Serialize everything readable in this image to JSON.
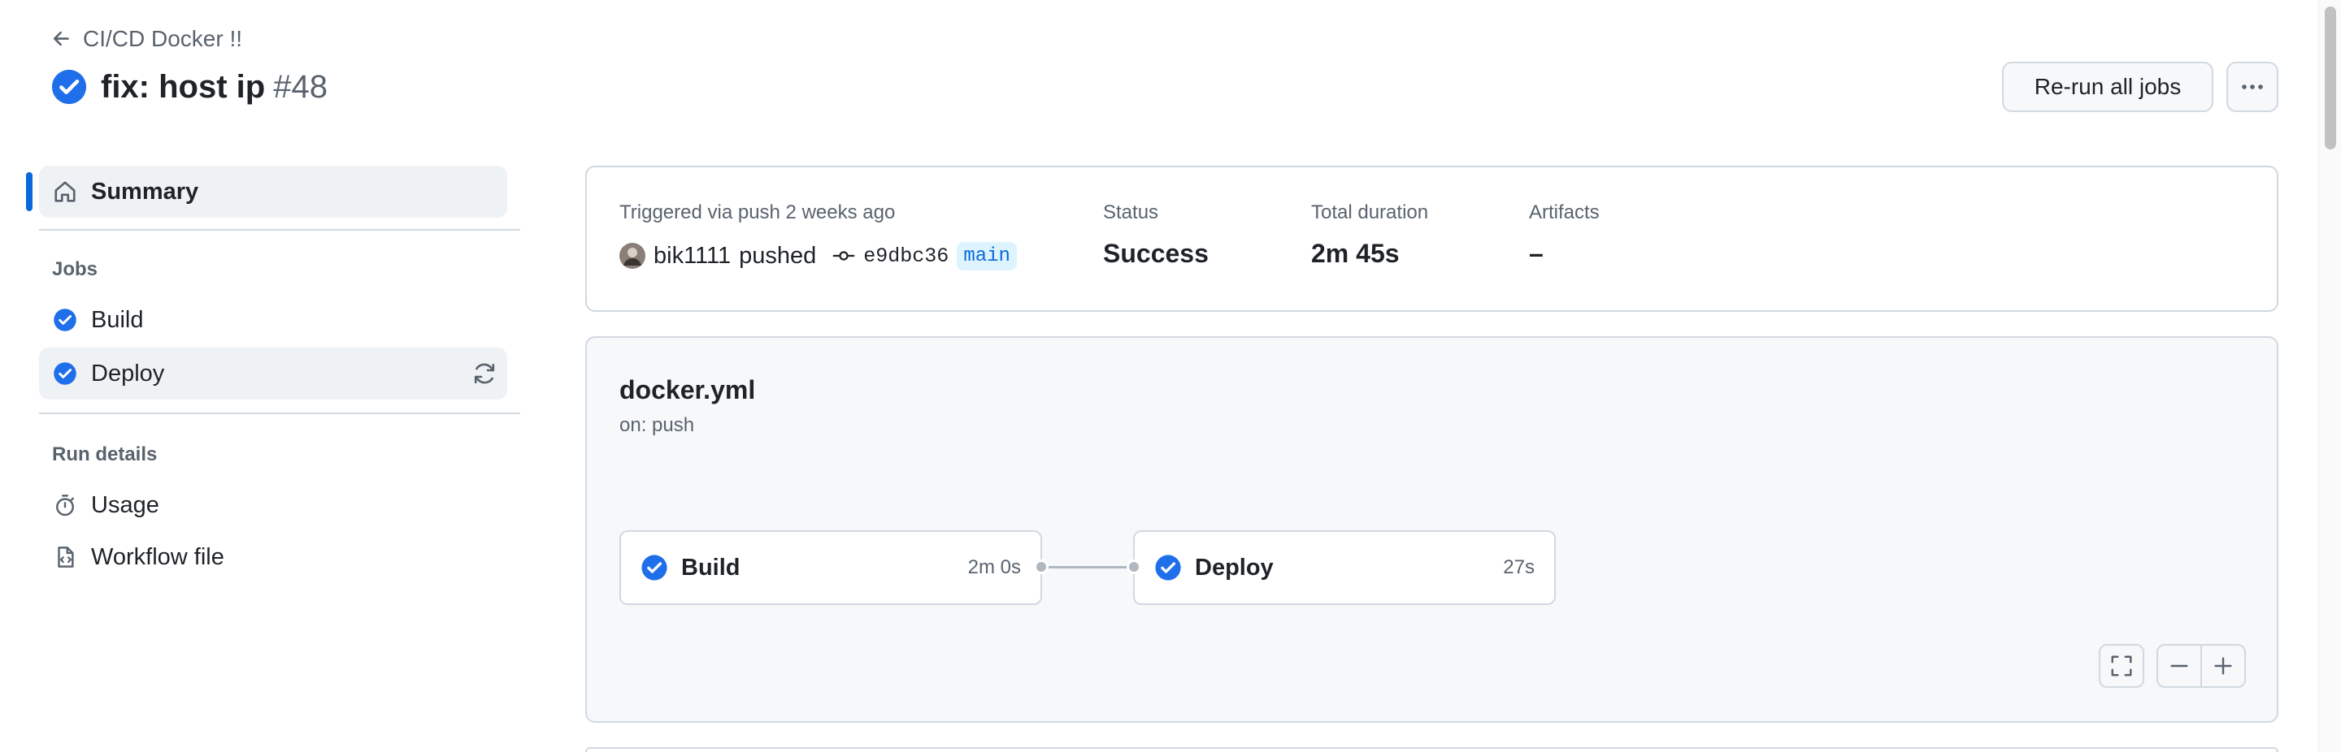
{
  "header": {
    "back_label": "CI/CD Docker !!",
    "title": "fix: host ip",
    "run_number": "#48",
    "rerun_label": "Re-run all jobs"
  },
  "sidebar": {
    "summary_label": "Summary",
    "jobs_heading": "Jobs",
    "jobs": [
      {
        "label": "Build"
      },
      {
        "label": "Deploy"
      }
    ],
    "run_details_heading": "Run details",
    "details": [
      {
        "label": "Usage"
      },
      {
        "label": "Workflow file"
      }
    ]
  },
  "summary": {
    "trigger_text": "Triggered via push 2 weeks ago",
    "actor": "bik1111",
    "action": "pushed",
    "commit": "e9dbc36",
    "branch": "main",
    "status_label": "Status",
    "status_value": "Success",
    "duration_label": "Total duration",
    "duration_value": "2m 45s",
    "artifacts_label": "Artifacts",
    "artifacts_value": "–"
  },
  "workflow": {
    "file": "docker.yml",
    "trigger": "on: push",
    "jobs": [
      {
        "name": "Build",
        "duration": "2m 0s"
      },
      {
        "name": "Deploy",
        "duration": "27s"
      }
    ]
  },
  "colors": {
    "success": "#1f6feb",
    "accent_bar": "#0969da",
    "border": "#d1d9e0",
    "muted_text": "#59636e",
    "panel_bg": "#f6f8fa",
    "branch_bg": "#ddf4ff"
  },
  "icons": {
    "back": "arrow-left-icon",
    "status": "check-circle-fill-icon",
    "more": "kebab-horizontal-icon",
    "summary": "home-icon",
    "job_status": "check-circle-fill-icon",
    "rerun": "sync-icon",
    "usage": "stopwatch-icon",
    "workflow_file": "file-code-icon",
    "commit": "git-commit-icon",
    "fullscreen": "screen-full-icon",
    "zoom_out": "dash-icon",
    "zoom_in": "plus-icon"
  }
}
